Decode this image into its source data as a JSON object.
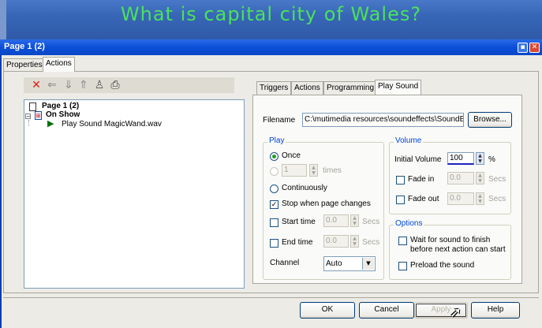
{
  "slide": {
    "title": "What is capital city of Wales?"
  },
  "dialog": {
    "title": "Page 1 (2)",
    "titlebar_buttons": [
      "restore",
      "close"
    ],
    "outer_tabs": [
      {
        "label": "Properties"
      },
      {
        "label": "Actions",
        "active": true
      }
    ],
    "toolbar_icons": [
      "delete-icon",
      "arrow-left-icon",
      "arrow-down-icon",
      "arrow-up-icon",
      "people-icon",
      "print-icon"
    ],
    "tree": {
      "root": "Page 1 (2)",
      "event": "On Show",
      "action": "Play Sound MagicWand.wav"
    },
    "inner_tabs": [
      {
        "label": "Triggers"
      },
      {
        "label": "Actions"
      },
      {
        "label": "Programming"
      },
      {
        "label": "Play Sound",
        "active": true
      }
    ],
    "play_sound": {
      "filename_label": "Filename",
      "filename_value": "C:\\mutimedia resources\\soundeffects\\SoundEf",
      "browse_label": "Browse...",
      "play": {
        "group_label": "Play",
        "once_label": "Once",
        "once_selected": true,
        "times_value": "1",
        "times_label": "times",
        "continuously_label": "Continuously",
        "stop_label": "Stop when page changes",
        "stop_checked": true,
        "start_time_label": "Start time",
        "start_time_value": "0.0",
        "end_time_label": "End time",
        "end_time_value": "0.0",
        "secs_label": "Secs",
        "channel_label": "Channel",
        "channel_value": "Auto"
      },
      "volume": {
        "group_label": "Volume",
        "initial_label": "Initial Volume",
        "initial_value": "100",
        "percent": "%",
        "fade_in_label": "Fade in",
        "fade_in_value": "0.0",
        "fade_out_label": "Fade out",
        "fade_out_value": "0.0",
        "secs_label": "Secs"
      },
      "options": {
        "group_label": "Options",
        "wait_label_1": "Wait for sound to finish",
        "wait_label_2": "before next action can start",
        "preload_label": "Preload the sound"
      }
    },
    "footer": {
      "ok": "OK",
      "cancel": "Cancel",
      "apply": "Apply",
      "help": "Help"
    }
  }
}
